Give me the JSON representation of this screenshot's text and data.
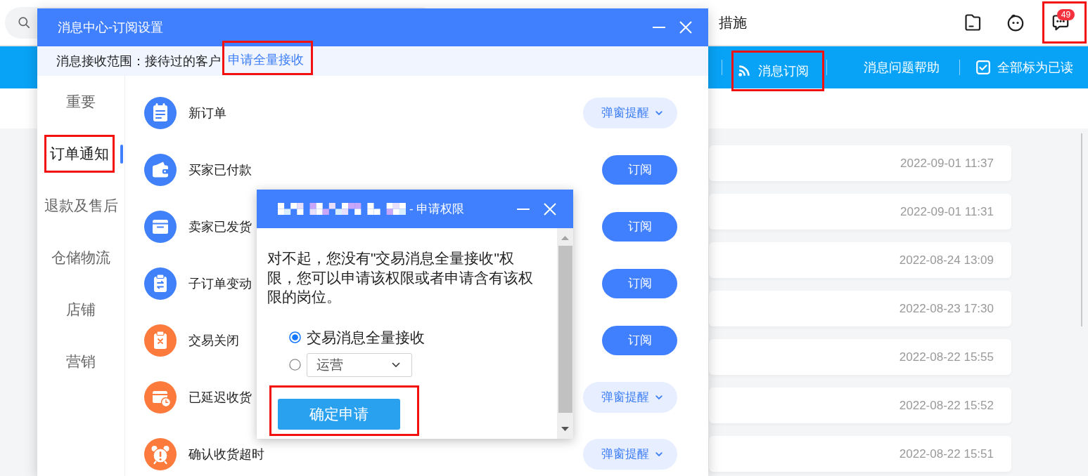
{
  "top_bar": {
    "notice": "措施",
    "icons": [
      {
        "highlighted": false
      },
      {
        "highlighted": false
      },
      {
        "badge": "49",
        "highlighted": true
      }
    ]
  },
  "nav_bar": {
    "items": [
      {
        "kind": "rss",
        "label": "消息订阅",
        "highlighted": true
      },
      {
        "kind": "plain",
        "label": "消息问题帮助",
        "highlighted": false
      },
      {
        "kind": "check",
        "label": "全部标为已读",
        "highlighted": false
      }
    ]
  },
  "message_list": {
    "rows": [
      {
        "time": "2022-09-01 11:37"
      },
      {
        "time": "2022-09-01 11:31"
      },
      {
        "time": "2022-08-24 13:09"
      },
      {
        "time": "2022-08-23 17:30"
      },
      {
        "time": "2022-08-22 15:55"
      },
      {
        "time": "2022-08-22 15:52"
      },
      {
        "time": "2022-08-22 15:51"
      }
    ]
  },
  "subscription_dialog": {
    "title": "消息中心-订阅设置",
    "scope_label": "消息接收范围：接待过的客户",
    "scope_link": {
      "label": "申请全量接收",
      "highlighted": true
    },
    "categories": [
      {
        "label": "重要",
        "selected": false,
        "highlighted": false
      },
      {
        "label": "订单通知",
        "selected": true,
        "highlighted": true
      },
      {
        "label": "退款及售后",
        "selected": false,
        "highlighted": false
      },
      {
        "label": "仓储物流",
        "selected": false,
        "highlighted": false
      },
      {
        "label": "店铺",
        "selected": false,
        "highlighted": false
      },
      {
        "label": "营销",
        "selected": false,
        "highlighted": false
      }
    ],
    "rows": [
      {
        "label": "新订单",
        "color": "#4080f8",
        "kind": "dropdown",
        "action": "弹窗提醒"
      },
      {
        "label": "买家已付款",
        "color": "#4080f8",
        "kind": "button",
        "action": "订阅"
      },
      {
        "label": "卖家已发货",
        "color": "#4080f8",
        "kind": "button",
        "action": "订阅"
      },
      {
        "label": "子订单变动",
        "color": "#4080f8",
        "kind": "button",
        "action": "订阅"
      },
      {
        "label": "交易关闭",
        "color": "#fb7a3c",
        "kind": "button",
        "action": "订阅"
      },
      {
        "label": "已延迟收货",
        "color": "#fb7a3c",
        "kind": "dropdown",
        "action": "弹窗提醒"
      },
      {
        "label": "确认收货超时",
        "color": "#fb7a3c",
        "kind": "dropdown",
        "action": "弹窗提醒"
      }
    ]
  },
  "permission_dialog": {
    "redacted_prefix": true,
    "title": "- 申请权限",
    "message": "对不起，您没有\"交易消息全量接收\"权限，您可以申请该权限或者申请含有该权限的岗位。",
    "options": [
      {
        "kind": "text",
        "label": "交易消息全量接收",
        "selected": true
      },
      {
        "kind": "select",
        "value": "运营",
        "selected": false
      }
    ],
    "confirm": {
      "label": "确定申请",
      "highlighted": true
    }
  }
}
